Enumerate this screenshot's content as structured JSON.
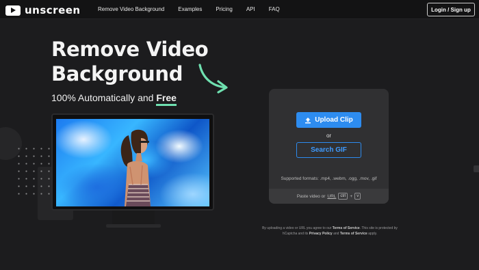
{
  "header": {
    "logo_text": "unscreen",
    "nav": [
      "Remove Video Background",
      "Examples",
      "Pricing",
      "API",
      "FAQ"
    ],
    "login_label": "Login / Sign up"
  },
  "hero": {
    "title_line1": "Remove Video",
    "title_line2": "Background",
    "subtitle": "100% Automatically and",
    "subtitle_highlight": "Free"
  },
  "upload": {
    "upload_label": "Upload Clip",
    "or_label": "or",
    "gif_label": "Search GIF",
    "formats": "Supported formats: .mp4, .webm, .ogg, .mov, .gif",
    "paste_prefix": "Paste video or",
    "paste_url": "URL",
    "kbd_ctrl": "ctrl",
    "kbd_plus": "+",
    "kbd_v": "v"
  },
  "legal": {
    "part1": "By uploading a video or URL you agree to our",
    "tos1": "Terms of Service",
    "part2": ". This site is protected by hCaptcha and its",
    "privacy": "Privacy Policy",
    "part3": "and",
    "tos2": "Terms of Service",
    "part4": "apply."
  },
  "colors": {
    "accent_blue": "#2d8cf0",
    "accent_green": "#6fe0b0",
    "background": "#1c1c1e"
  }
}
